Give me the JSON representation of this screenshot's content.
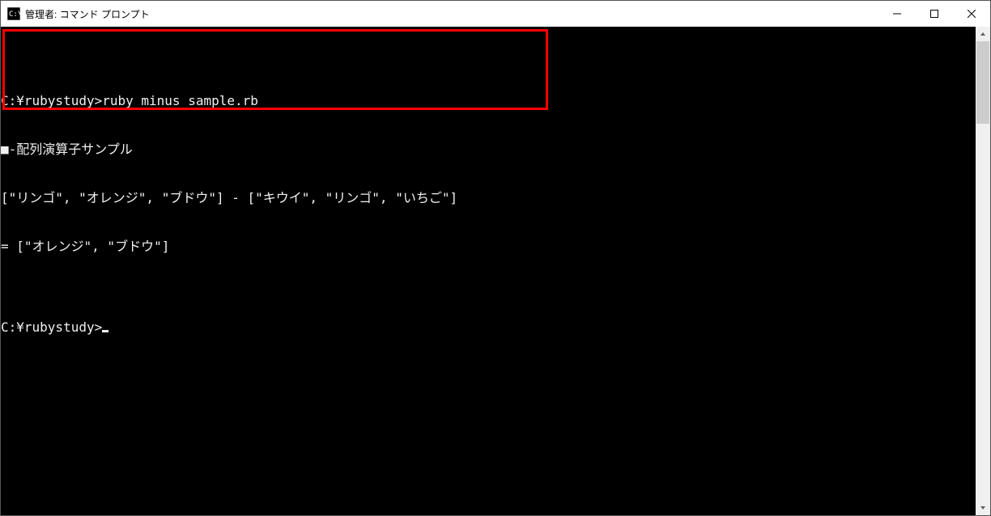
{
  "window": {
    "title": "管理者: コマンド プロンプト"
  },
  "terminal": {
    "lines": [
      "",
      "C:¥rubystudy>ruby minus_sample.rb",
      "■-配列演算子サンプル",
      "[\"リンゴ\", \"オレンジ\", \"ブドウ\"] - [\"キウイ\", \"リンゴ\", \"いちご\"]",
      "= [\"オレンジ\", \"ブドウ\"]",
      "",
      "C:¥rubystudy>"
    ]
  },
  "scrollbar": {
    "thumb_top_pct": 0,
    "thumb_height_pct": 18
  }
}
